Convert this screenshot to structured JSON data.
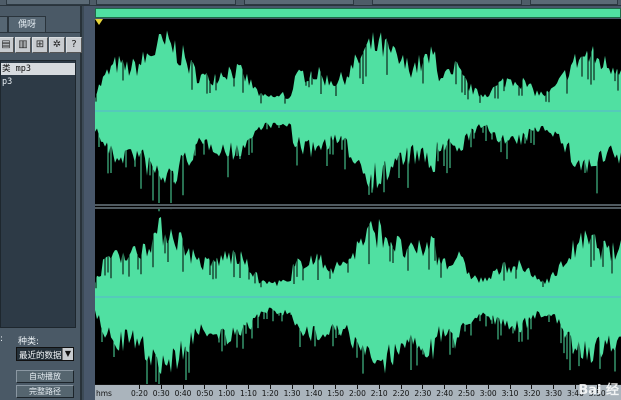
{
  "tabs": [
    {
      "label": ""
    },
    {
      "label": "偶呀"
    }
  ],
  "toolbar": {
    "buttons": [
      {
        "icon": "open-file-icon"
      },
      {
        "icon": "edit-icon"
      },
      {
        "icon": "insert-icon"
      },
      {
        "icon": "refresh-icon"
      },
      {
        "icon": "help-icon",
        "label": "?"
      }
    ]
  },
  "file_list": {
    "items": [
      {
        "label": "类 mp3"
      },
      {
        "label": "p3"
      }
    ]
  },
  "filter": {
    "label_left": ":",
    "label_type": "种类:",
    "select_value": "最近的数据"
  },
  "buttons": {
    "auto_play": "自动播放",
    "full_path": "完整路径"
  },
  "ruler": {
    "unit": "hms",
    "labels": [
      "0:20",
      "0:30",
      "0:40",
      "0:50",
      "1:00",
      "1:10",
      "1:20",
      "1:30",
      "1:40",
      "1:50",
      "2:00",
      "2:10",
      "2:20",
      "2:30",
      "2:40",
      "2:50",
      "3:00",
      "3:10",
      "3:20",
      "3:30",
      "3:40",
      "3:50"
    ]
  },
  "colors": {
    "waveform": "#50e0a2",
    "background": "#000000",
    "center_line": "#5ab5d3"
  },
  "watermark": "Bai 经"
}
